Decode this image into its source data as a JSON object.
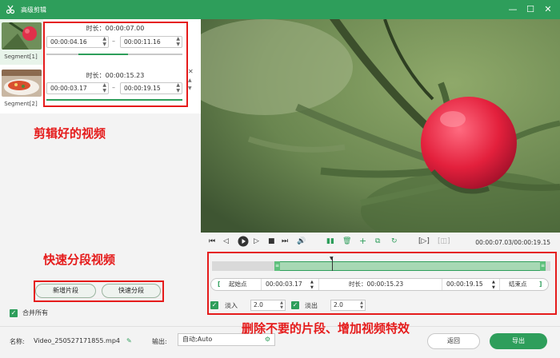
{
  "window": {
    "title": "高级剪辑",
    "minimize": "—",
    "maximize": "☐",
    "close": "✕"
  },
  "segments": [
    {
      "label": "Segment[1]",
      "duration": "时长：00:00:07.00",
      "start": "00:00:04.16",
      "end": "00:00:11.16",
      "selected": true
    },
    {
      "label": "Segment[2]",
      "duration": "时长：00:00:15.23",
      "start": "00:00:03.17",
      "end": "00:00:19.15",
      "selected": false
    }
  ],
  "segment_dash": "–",
  "left_buttons": {
    "add_segment": "新增片段",
    "quick_split": "快速分段"
  },
  "merge_all": "合并所有",
  "annotations": {
    "clipped_videos": "剪辑好的视频",
    "quick_split_video": "快速分段视频",
    "delete_and_effects": "删除不要的片段、增加视频特效"
  },
  "player": {
    "time_readout": "00:00:07.03/00:00:19.15"
  },
  "trim": {
    "start_point": "起始点",
    "start_value": "00:00:03.17",
    "duration": "时长：00:00:15.23",
    "end_value": "00:00:19.15",
    "end_point": "结束点",
    "left_bracket": "[",
    "right_bracket": "]"
  },
  "effects": {
    "fade_in_label": "淡入",
    "fade_in_value": "2.0",
    "fade_out_label": "淡出",
    "fade_out_value": "2.0"
  },
  "bottom": {
    "name_label": "名称:",
    "name_value": "Video_250527171855.mp4",
    "output_label": "输出:",
    "output_value": "自动;Auto",
    "back": "返回",
    "export": "导出"
  },
  "colors": {
    "accent": "#2e9e5b",
    "annotation": "#e51b1b"
  }
}
